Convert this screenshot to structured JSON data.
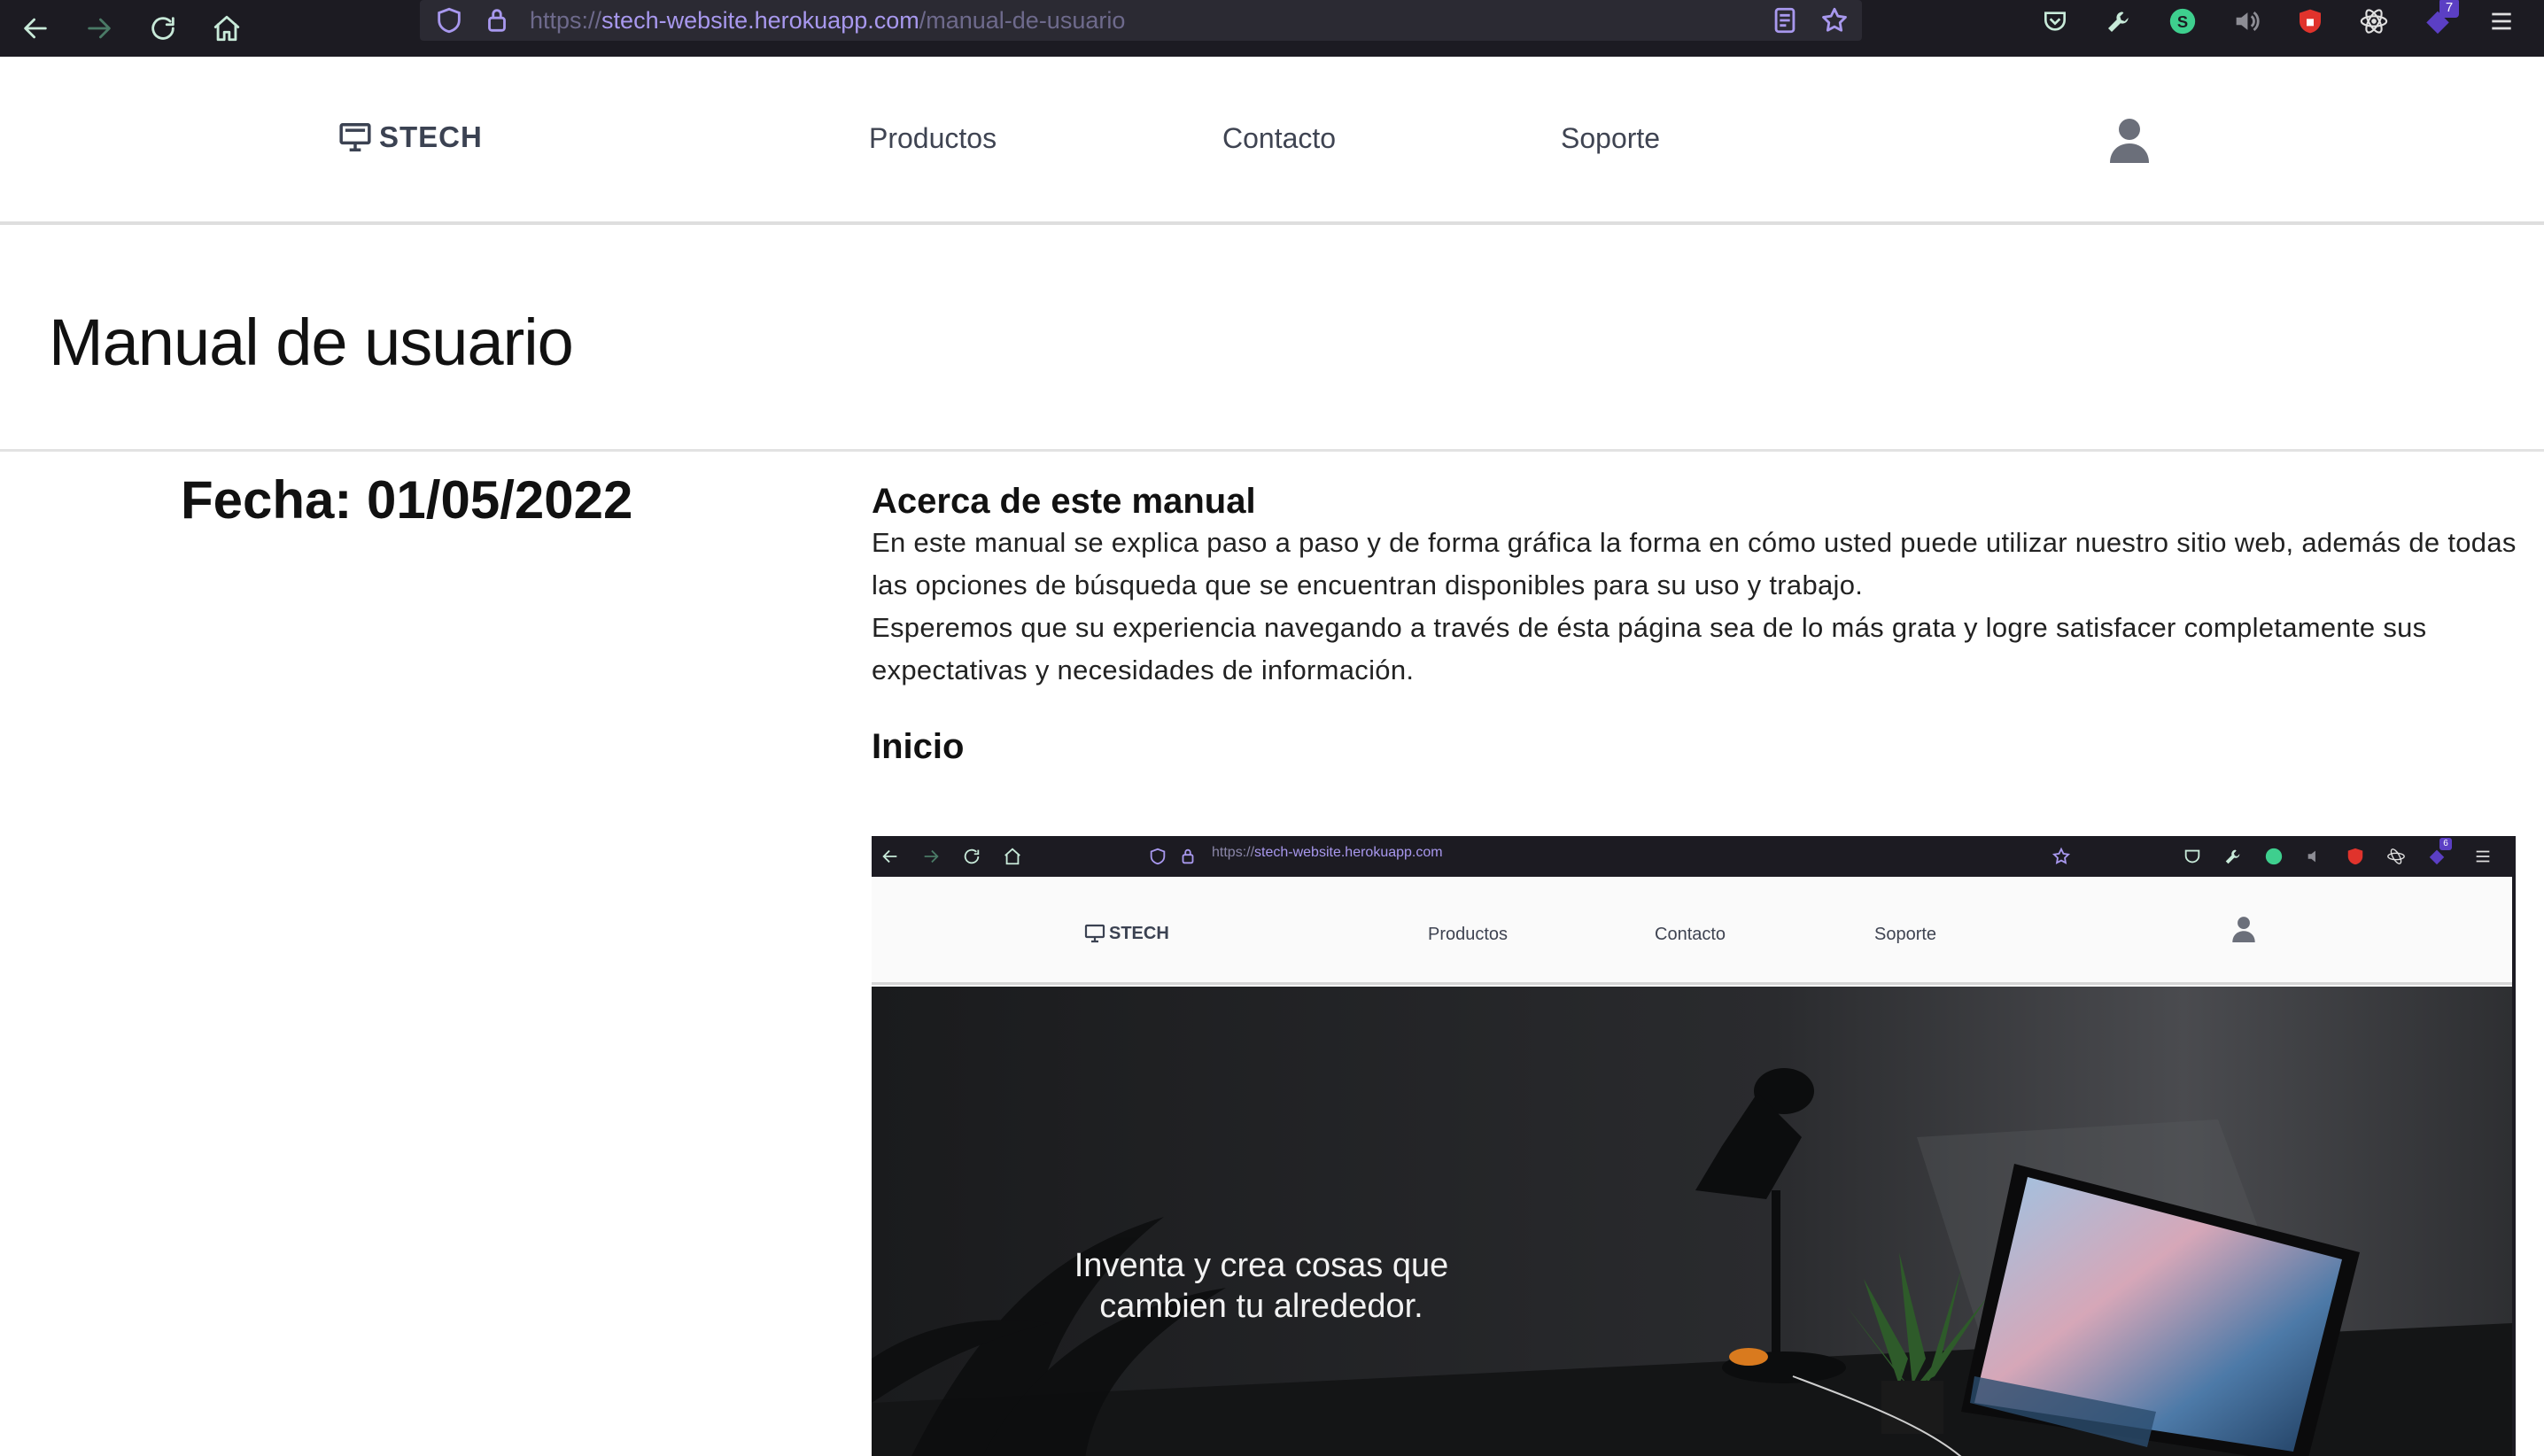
{
  "browser": {
    "url_scheme": "https://",
    "url_host": "stech-website.herokuapp.com",
    "url_path": "/manual-de-usuario",
    "badge_count": "7"
  },
  "site": {
    "logo_text": "STECH",
    "nav": [
      "Productos",
      "Contacto",
      "Soporte"
    ]
  },
  "page": {
    "title": "Manual de usuario",
    "fecha": "Fecha: 01/05/2022"
  },
  "manual": {
    "about_title": "Acerca de este manual",
    "about_p1": "En este manual se explica paso a paso y de forma gráfica la forma en cómo usted puede utilizar nuestro sitio web, además de todas las opciones de búsqueda que se encuentran disponibles para su uso y trabajo.",
    "about_p2": "Esperemos que su experiencia navegando a través de ésta página sea de lo más grata y logre satisfacer completamente sus expectativas y necesidades de información.",
    "inicio_title": "Inicio"
  },
  "screenshot": {
    "url_scheme": "https://",
    "url_host": "stech-website.herokuapp.com",
    "badge_count": "6",
    "logo_text": "STECH",
    "nav": [
      "Productos",
      "Contacto",
      "Soporte"
    ],
    "hero_text": "Inventa y crea cosas que cambien tu alrededor."
  },
  "colors": {
    "chrome_bg": "#1c1b22",
    "url_host": "#a898ee",
    "text_dark": "#111111",
    "nav_text": "#3f4452"
  }
}
